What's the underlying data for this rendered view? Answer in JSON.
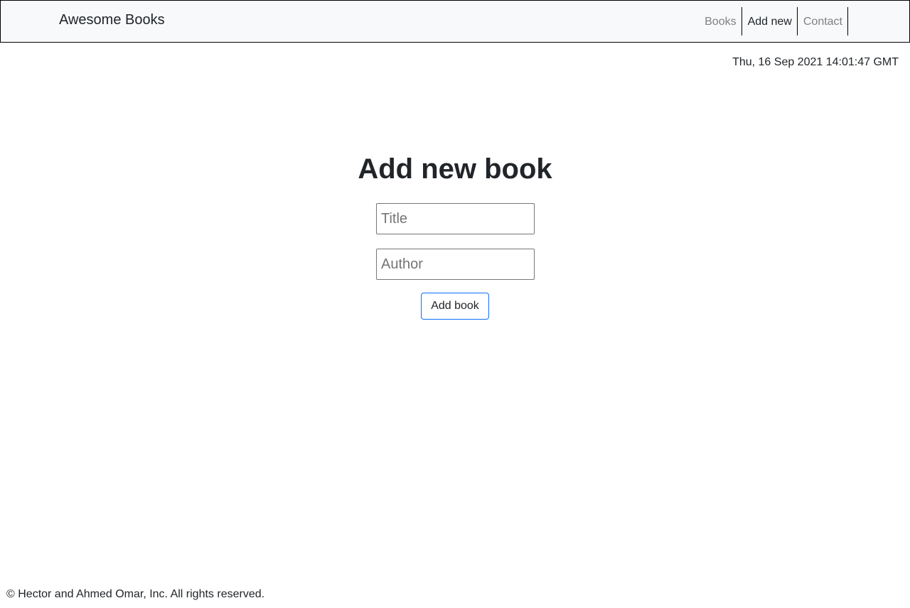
{
  "navbar": {
    "brand": "Awesome Books",
    "links": [
      {
        "label": "Books",
        "active": false
      },
      {
        "label": "Add new",
        "active": true
      },
      {
        "label": "Contact",
        "active": false
      }
    ]
  },
  "datetime": "Thu, 16 Sep 2021 14:01:47 GMT",
  "form": {
    "heading": "Add new book",
    "title_placeholder": "Title",
    "title_value": "",
    "author_placeholder": "Author",
    "author_value": "",
    "submit_label": "Add book"
  },
  "footer": {
    "text": "© Hector and Ahmed Omar, Inc. All rights reserved."
  },
  "colors": {
    "navbar_bg": "#f8f9fa",
    "button_border": "#0d6efd",
    "muted_link": "#808080",
    "text": "#212529"
  }
}
